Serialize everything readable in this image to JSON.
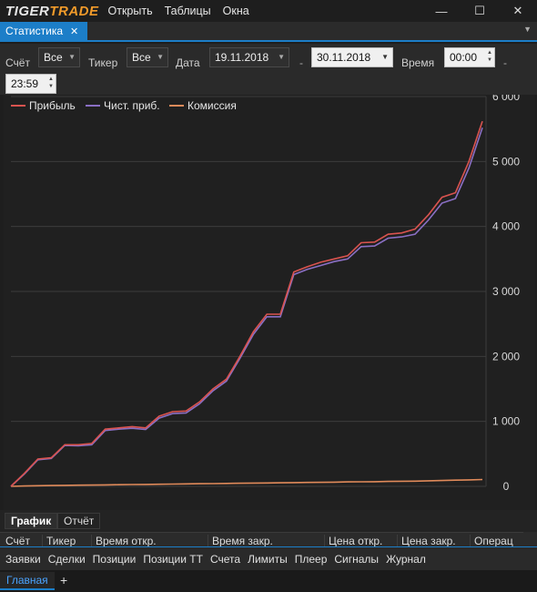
{
  "app": {
    "logo_part1": "TIGER",
    "logo_part2": "TRADE",
    "menu": [
      "Открыть",
      "Таблицы",
      "Окна"
    ]
  },
  "window_controls": {
    "minimize": "—",
    "maximize": "☐",
    "close": "✕"
  },
  "tabs": {
    "active_label": "Статистика",
    "close_glyph": "✕"
  },
  "filters": {
    "account_label": "Счёт",
    "account_value": "Все",
    "ticker_label": "Тикер",
    "ticker_value": "Все",
    "date_label": "Дата",
    "date_from": "19.11.2018",
    "date_sep": "-",
    "date_to": "30.11.2018",
    "time_label": "Время",
    "time_from": "00:00",
    "time_sep": "-",
    "time_to": "23:59"
  },
  "chart_data": {
    "type": "line",
    "yticks": [
      "6 000",
      "5 000",
      "4 000",
      "3 000",
      "2 000",
      "1 000",
      "0"
    ],
    "ylim": [
      0,
      6000
    ],
    "grid": true,
    "legend_position": "top-left",
    "series": [
      {
        "name": "Прибыль",
        "color": "#d9534f",
        "values": [
          0,
          200,
          420,
          440,
          640,
          640,
          660,
          880,
          900,
          920,
          900,
          1080,
          1150,
          1160,
          1300,
          1500,
          1650,
          2000,
          2380,
          2650,
          2650,
          3300,
          3380,
          3450,
          3500,
          3550,
          3750,
          3760,
          3880,
          3900,
          3960,
          4180,
          4450,
          4520,
          5000,
          5620
        ]
      },
      {
        "name": "Чист. приб.",
        "color": "#8a6fc4",
        "values": [
          0,
          190,
          410,
          430,
          630,
          625,
          640,
          860,
          880,
          895,
          875,
          1050,
          1120,
          1130,
          1270,
          1470,
          1620,
          1970,
          2340,
          2610,
          2610,
          3260,
          3340,
          3400,
          3460,
          3500,
          3690,
          3700,
          3820,
          3840,
          3880,
          4100,
          4360,
          4430,
          4900,
          5520
        ]
      },
      {
        "name": "Комиссия",
        "color": "#e08a5a",
        "values": [
          0,
          5,
          10,
          12,
          15,
          18,
          20,
          22,
          25,
          28,
          30,
          32,
          35,
          38,
          40,
          42,
          45,
          48,
          50,
          52,
          55,
          58,
          60,
          62,
          65,
          68,
          70,
          72,
          75,
          78,
          80,
          85,
          90,
          95,
          100,
          105
        ]
      }
    ]
  },
  "subtabs": [
    "График",
    "Отчёт"
  ],
  "table_headers": [
    "Счёт",
    "Тикер",
    "Время откр.",
    "Время закр.",
    "Цена откр.",
    "Цена закр.",
    "Операц"
  ],
  "panel_tabs": [
    "Заявки",
    "Сделки",
    "Позиции",
    "Позиции ТТ",
    "Счета",
    "Лимиты",
    "Плеер",
    "Сигналы",
    "Журнал"
  ],
  "workspace": {
    "active_tab": "Главная",
    "add_glyph": "+"
  }
}
